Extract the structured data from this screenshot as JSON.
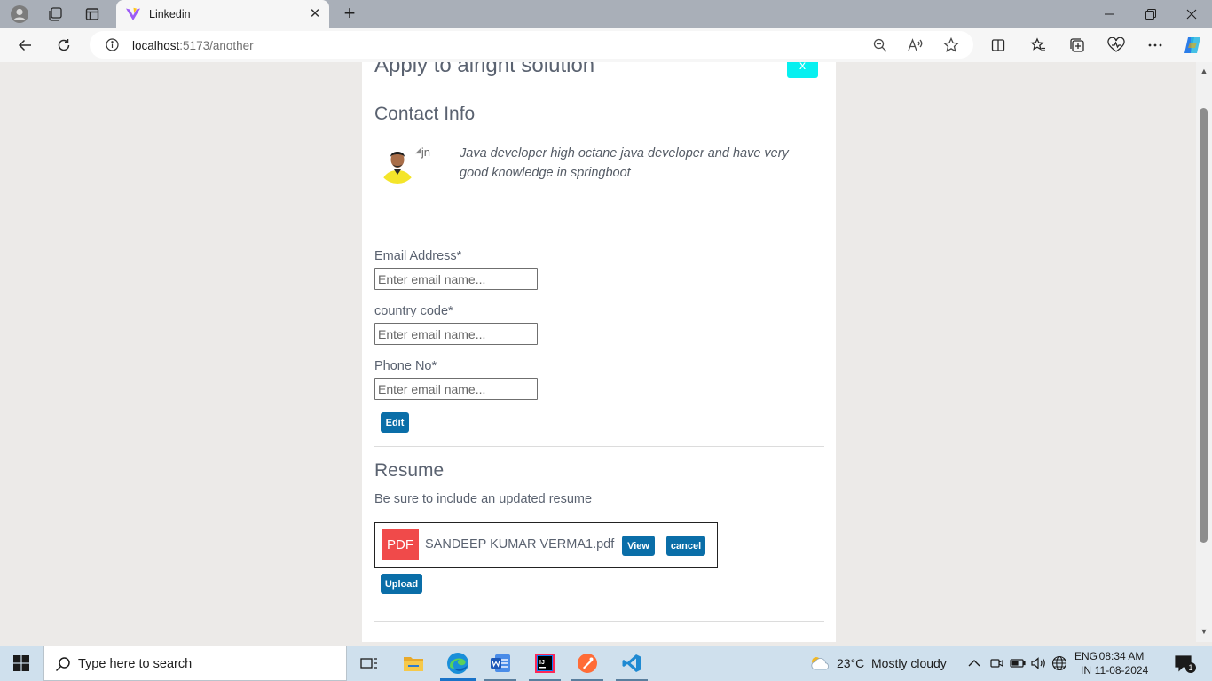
{
  "browser": {
    "tab_title": "Linkedin",
    "url_host": "localhost",
    "url_rest": ":5173/another"
  },
  "modal": {
    "title": "Apply to alright solution",
    "close_label": "x",
    "contact_heading": "Contact Info",
    "broken_img_alt": "jn",
    "about": "Java developer high octane java developer and have very good knowledge in springboot",
    "email_label": "Email Address*",
    "email_placeholder": "Enter email name...",
    "country_label": "country code*",
    "country_placeholder": "Enter email name...",
    "phone_label": "Phone No*",
    "phone_placeholder": "Enter email name...",
    "edit_label": "Edit",
    "resume_heading": "Resume",
    "resume_hint": "Be sure to include an updated resume",
    "pdf_badge": "PDF",
    "file_name": "SANDEEP KUMAR VERMA1.pdf",
    "view_label": "View",
    "cancel_label": "cancel",
    "upload_label": "Upload"
  },
  "taskbar": {
    "search_placeholder": "Type here to search",
    "weather_temp": "23°C",
    "weather_desc": "Mostly cloudy",
    "lang_line1": "ENG",
    "lang_line2": "IN",
    "time": "08:34 AM",
    "date": "11-08-2024",
    "notification_count": "1"
  },
  "colors": {
    "accent_button": "#0a6ea8",
    "close_button": "#07f0f0",
    "pdf_badge": "#f04a4a",
    "page_bg": "#eceae8"
  }
}
